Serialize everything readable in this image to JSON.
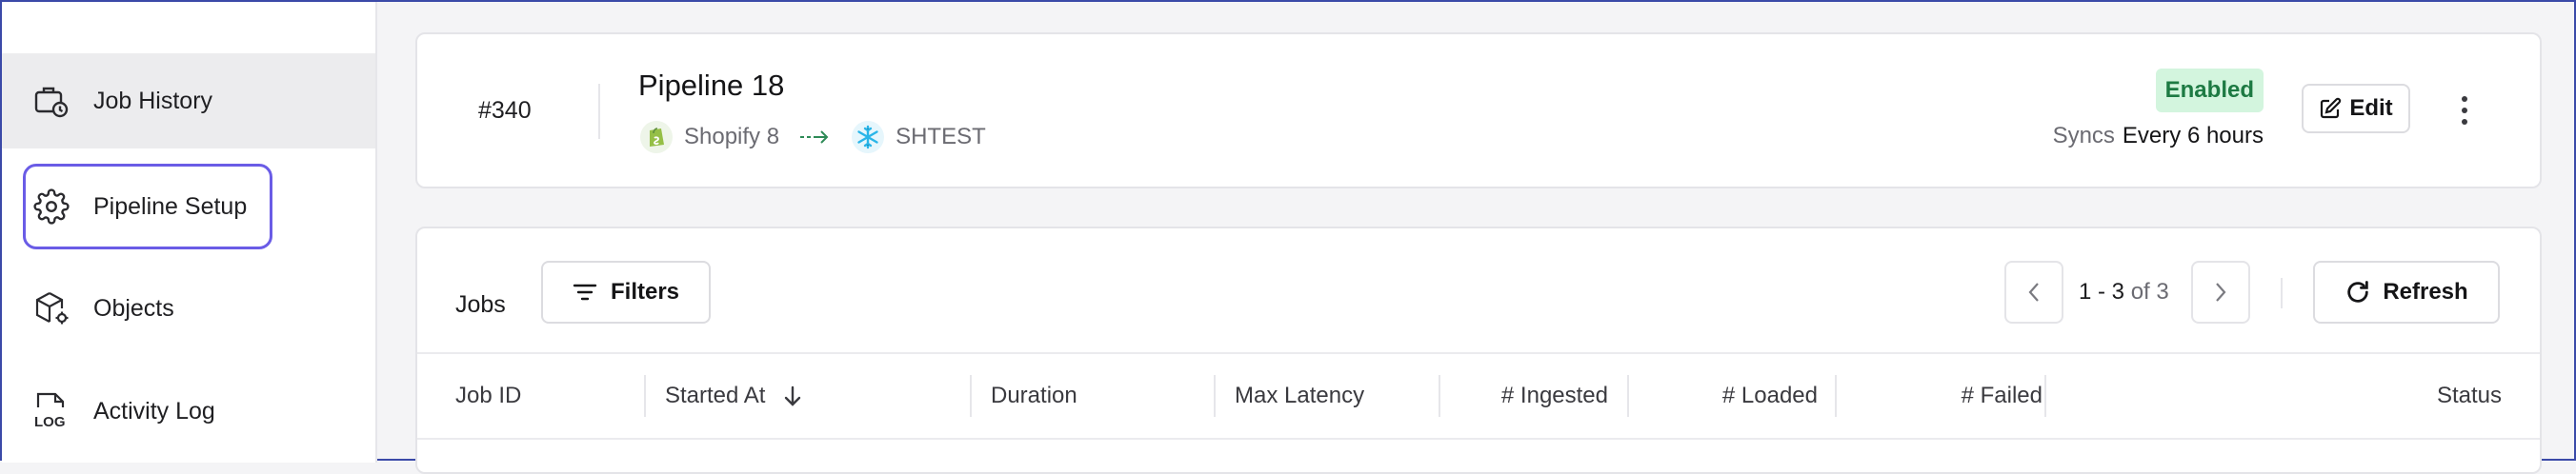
{
  "sidebar": {
    "items": [
      {
        "label": "Job History",
        "icon": "briefcase-clock-icon",
        "active": true
      },
      {
        "label": "Pipeline Setup",
        "icon": "gear-icon",
        "focused": true
      },
      {
        "label": "Objects",
        "icon": "cube-settings-icon"
      },
      {
        "label": "Activity Log",
        "icon": "log-file-icon",
        "icon_text": "LOG"
      }
    ]
  },
  "pipeline": {
    "id": "#340",
    "name": "Pipeline 18",
    "source": {
      "label": "Shopify 8",
      "icon": "shopify-icon"
    },
    "destination": {
      "label": "SHTEST",
      "icon": "snowflake-icon"
    },
    "status_badge": "Enabled",
    "syncs_label": "Syncs",
    "syncs_value": "Every 6 hours",
    "edit_label": "Edit",
    "menu_icon": "kebab-menu-icon"
  },
  "jobs": {
    "title": "Jobs",
    "filters_label": "Filters",
    "pagination": {
      "range": "1 - 3",
      "of_label": "of 3"
    },
    "refresh_label": "Refresh",
    "columns": [
      "Job ID",
      "Started At",
      "Duration",
      "Max Latency",
      "# Ingested",
      "# Loaded",
      "# Failed",
      "Status"
    ]
  },
  "colors": {
    "accent_focus": "#6a5ce6",
    "badge_bg": "#d3f5de",
    "badge_text": "#1d7a43",
    "arrow": "#2e8b57"
  }
}
